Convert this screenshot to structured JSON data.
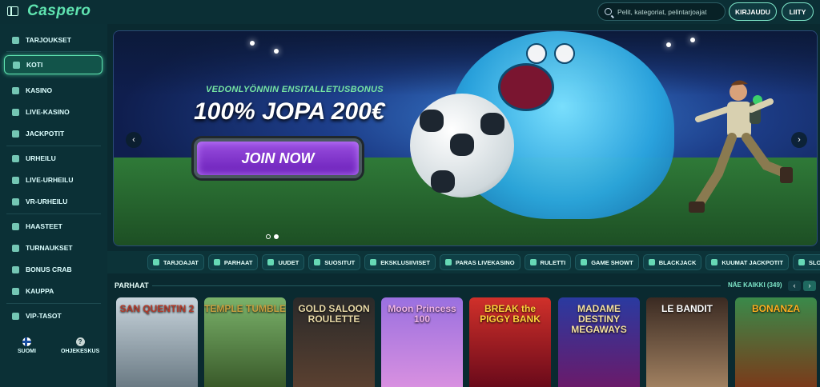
{
  "header": {
    "logo": "Caspero",
    "search_placeholder": "Pelit, kategoriat, pelintarjoajat",
    "login_label": "KIRJAUDU",
    "join_label": "LIITY"
  },
  "sidebar": {
    "items": [
      {
        "label": "TARJOUKSET",
        "icon": "gift-icon"
      },
      {
        "label": "KOTI",
        "icon": "home-icon",
        "active": true
      },
      {
        "label": "KASINO",
        "icon": "slot-icon"
      },
      {
        "label": "LIVE-KASINO",
        "icon": "cards-icon"
      },
      {
        "label": "JACKPOTIT",
        "icon": "coins-icon"
      },
      {
        "label": "URHEILU",
        "icon": "ball-icon"
      },
      {
        "label": "LIVE-URHEILU",
        "icon": "live-icon"
      },
      {
        "label": "VR-URHEILU",
        "icon": "vr-icon"
      },
      {
        "label": "HAASTEET",
        "icon": "target-icon"
      },
      {
        "label": "TURNAUKSET",
        "icon": "trophy-icon"
      },
      {
        "label": "BONUS CRAB",
        "icon": "crab-icon"
      },
      {
        "label": "KAUPPA",
        "icon": "shop-icon"
      },
      {
        "label": "VIP-TASOT",
        "icon": "diamond-icon"
      }
    ],
    "footer": {
      "language": "SUOMI",
      "help": "OHJEKESKUS"
    }
  },
  "hero": {
    "subtitle": "VEDONLYÖNNIN ENSITALLETUSBONUS",
    "title": "100% JOPA 200€",
    "cta": "JOIN NOW",
    "slide_count": 2,
    "active_slide": 2
  },
  "categories": [
    "TARJOAJAT",
    "PARHAAT",
    "UUDET",
    "SUOSITUT",
    "EKSKLUSIIVISET",
    "PARAS LIVEKASINO",
    "RULETTI",
    "GAME SHOWT",
    "BLACKJACK",
    "KUUMAT JACKPOTIT",
    "SLOTIT"
  ],
  "section": {
    "title": "PARHAAT",
    "see_all": "NÄE KAIKKI (349)"
  },
  "games": [
    {
      "title": "SAN QUENTIN 2",
      "color": "#b23a2a"
    },
    {
      "title": "TEMPLE TUMBLE",
      "color": "#c8a040"
    },
    {
      "title": "GOLD SALOON ROULETTE",
      "color": "#e8d9a6"
    },
    {
      "title": "Moon Princess 100",
      "color": "#f2b4e8"
    },
    {
      "title": "BREAK the PIGGY BANK",
      "color": "#ffd23a"
    },
    {
      "title": "MADAME DESTINY MEGAWAYS",
      "color": "#f4e0a0"
    },
    {
      "title": "LE BANDIT",
      "color": "#ffffff"
    },
    {
      "title": "BONANZA",
      "color": "#ffb020"
    }
  ]
}
